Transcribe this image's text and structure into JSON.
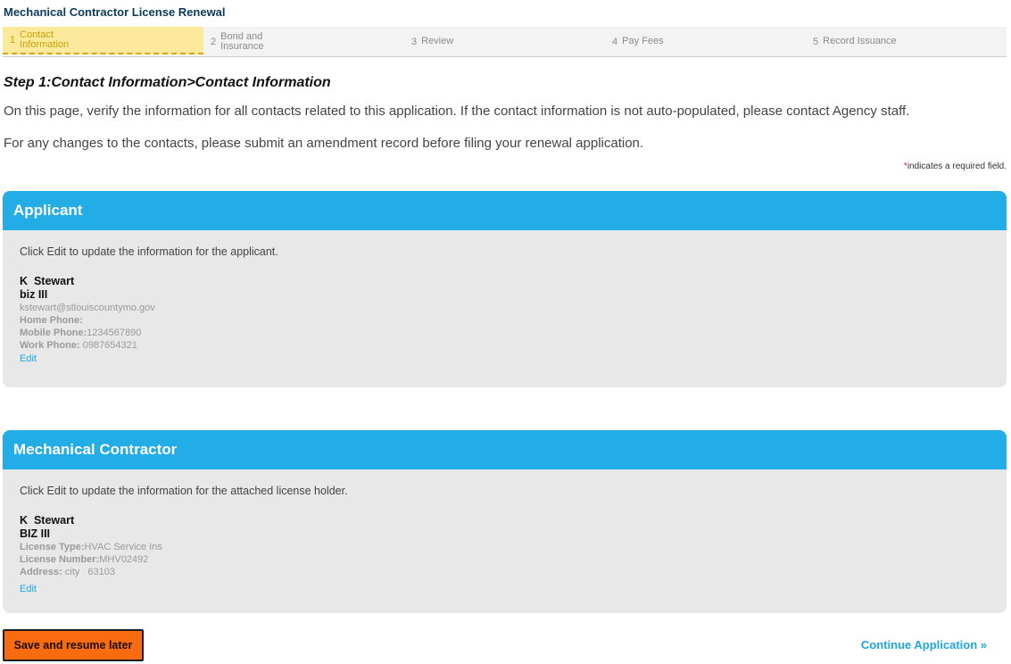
{
  "app": {
    "title": "Mechanical Contractor License Renewal"
  },
  "steps": [
    {
      "num": "1",
      "label_line1": "Contact",
      "label_line2": "Information",
      "active": true
    },
    {
      "num": "2",
      "label_line1": "Bond and",
      "label_line2": "Insurance",
      "active": false
    },
    {
      "num": "3",
      "label_line1": "Review",
      "label_line2": "",
      "active": false
    },
    {
      "num": "4",
      "label_line1": "Pay Fees",
      "label_line2": "",
      "active": false
    },
    {
      "num": "5",
      "label_line1": "Record Issuance",
      "label_line2": "",
      "active": false
    }
  ],
  "page": {
    "heading": "Step 1:Contact Information>Contact Information",
    "intro1": "On this page, verify the information for all contacts related to this application. If the contact information is not auto-populated, please contact Agency staff.",
    "intro2": "For any changes to the contacts, please submit an amendment record before filing your renewal application.",
    "required_star": "*",
    "required_note": "indicates a required field."
  },
  "applicant": {
    "title": "Applicant",
    "instruction": "Click Edit to update the information for the applicant.",
    "name": "K  Stewart",
    "business": "biz III",
    "email": "kstewart@stlouiscountymo.gov",
    "home_phone_label": "Home Phone:",
    "home_phone": "",
    "mobile_phone_label": "Mobile Phone:",
    "mobile_phone": "1234567890",
    "work_phone_label": "Work Phone:",
    "work_phone": " 0987654321",
    "edit_label": "Edit"
  },
  "contractor": {
    "title": "Mechanical Contractor",
    "instruction": "Click Edit to update the information for the attached license holder.",
    "name": "K  Stewart",
    "business": "BIZ III",
    "license_type_label": "License Type:",
    "license_type": "HVAC Service Ins",
    "license_number_label": "License Number:",
    "license_number": "MHV02492",
    "address_label": "Address:",
    "address": " city   63103",
    "edit_label": "Edit"
  },
  "footer": {
    "save_label": "Save and resume later",
    "continue_label": "Continue Application »"
  },
  "colors": {
    "panel_header": "#22ade7",
    "active_step_bg": "#fde99b",
    "save_button": "#f96b0f",
    "link": "#1da6df"
  }
}
